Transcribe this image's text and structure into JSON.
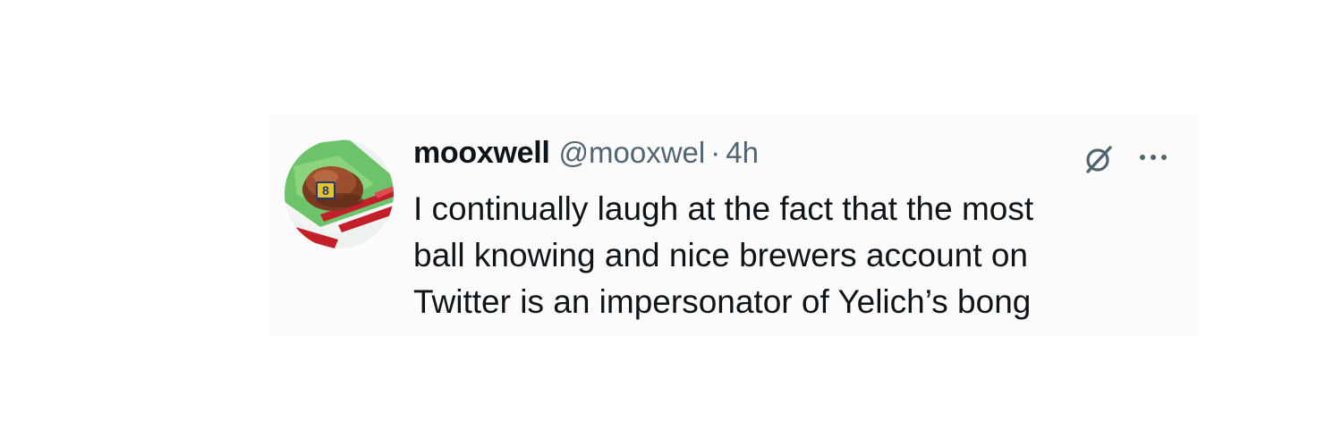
{
  "tweet": {
    "display_name": "mooxwell",
    "handle": "@mooxwel",
    "separator": "·",
    "timestamp": "4h",
    "text_lines": [
      "I continually laugh at the fact that the most",
      "ball knowing and nice brewers account on",
      "Twitter is an impersonator of Yelich’s bong"
    ],
    "avatar_badge": "8"
  },
  "icons": {
    "grok": "grok-icon",
    "more": "more-options-icon"
  },
  "colors": {
    "primary_text": "#0f1419",
    "secondary_text": "#536471",
    "card_background": "#fcfcfc"
  }
}
